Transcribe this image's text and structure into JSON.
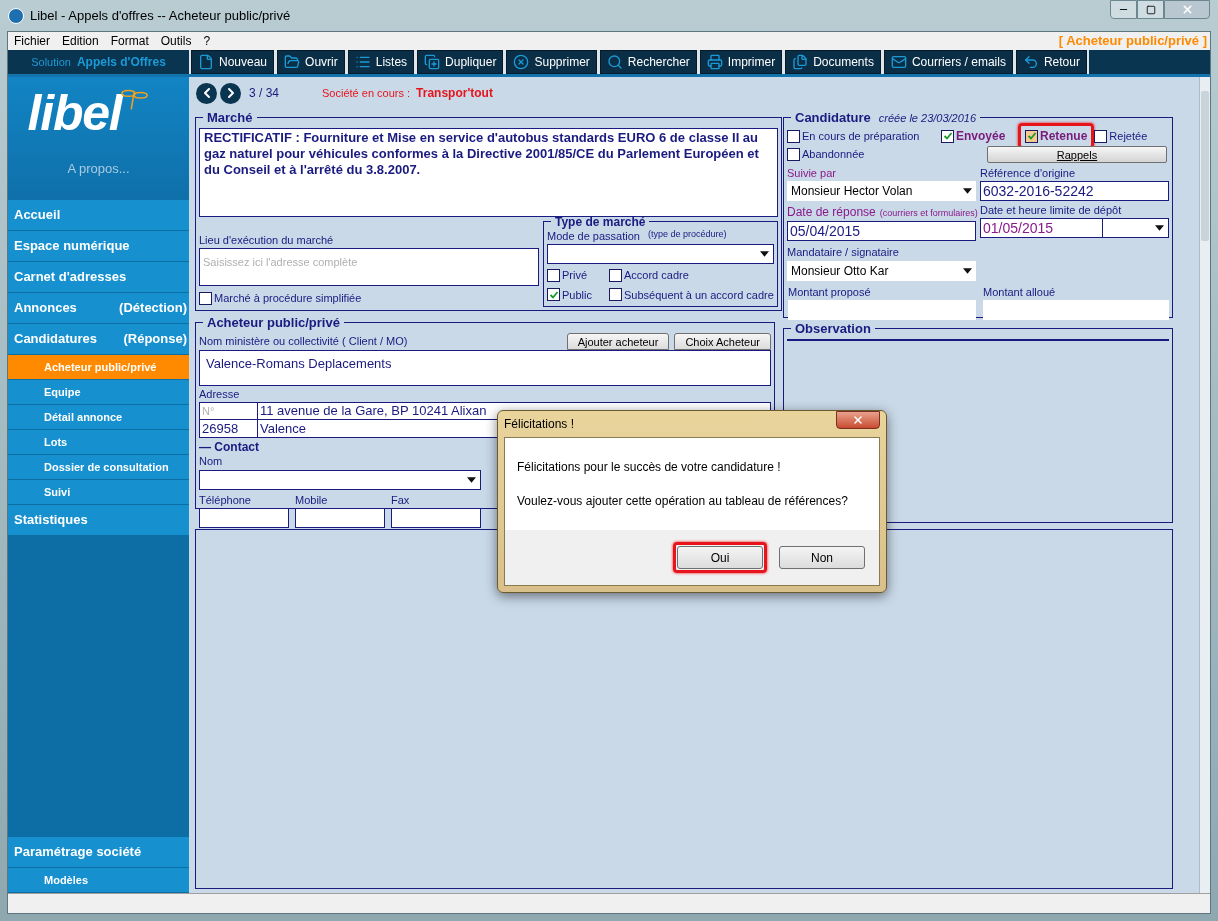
{
  "window": {
    "title": "Libel - Appels d'offres -- Acheteur public/privé"
  },
  "menu": [
    "Fichier",
    "Edition",
    "Format",
    "Outils",
    "?"
  ],
  "current_section": "[ Acheteur public/privé ]",
  "brand": {
    "prefix": "Solution",
    "name": "Appels d'Offres"
  },
  "toolbar": [
    {
      "label": "Nouveau",
      "kind": "new"
    },
    {
      "label": "Ouvrir",
      "kind": "open"
    },
    {
      "label": "Listes",
      "kind": "list"
    },
    {
      "label": "Dupliquer",
      "kind": "duplicate"
    },
    {
      "label": "Supprimer",
      "kind": "delete"
    },
    {
      "label": "Rechercher",
      "kind": "search"
    },
    {
      "label": "Imprimer",
      "kind": "print"
    },
    {
      "label": "Documents",
      "kind": "documents"
    },
    {
      "label": "Courriers / emails",
      "kind": "mail"
    },
    {
      "label": "Retour",
      "kind": "back"
    }
  ],
  "sidebar": {
    "logo": "libel",
    "about": "A propos...",
    "items": [
      {
        "label": "Accueil",
        "selected": false
      },
      {
        "label": "Espace numérique",
        "selected": false
      },
      {
        "label": "Carnet d'adresses",
        "selected": false
      },
      {
        "label": "Annonces",
        "note": "(Détection)",
        "selected": false
      },
      {
        "label": "Candidatures",
        "note": "(Réponse)",
        "selected": false,
        "children": [
          {
            "label": "Acheteur public/privé",
            "selected": true
          },
          {
            "label": "Equipe",
            "selected": false
          },
          {
            "label": "Détail annonce",
            "selected": false
          },
          {
            "label": "Lots",
            "selected": false
          },
          {
            "label": "Dossier de consultation",
            "selected": false
          },
          {
            "label": "Suivi",
            "selected": false
          }
        ]
      },
      {
        "label": "Statistiques",
        "selected": false
      }
    ],
    "footer_items": [
      {
        "label": "Paramétrage société",
        "selected": false,
        "children": [
          {
            "label": "Modèles",
            "selected": false
          }
        ]
      }
    ]
  },
  "nav": {
    "position": "3 / 34",
    "company_label": "Société en cours :",
    "company": "Transpor'tout"
  },
  "marche": {
    "title": "Marché",
    "description": "RECTIFICATIF : Fourniture et Mise en service d'autobus standards EURO 6 de classe II au gaz naturel pour véhicules conformes à la Directive 2001/85/CE du Parlement Européen et du Conseil et à l'arrêté du 3.8.2007.",
    "lieu_label": "Lieu d'exécution du marché",
    "lieu_placeholder": "Saisissez ici l'adresse complète",
    "simplified": {
      "label": "Marché à procédure simplifiée",
      "checked": false
    },
    "type": {
      "title": "Type de marché",
      "mode_label": "Mode de passation",
      "mode_hint": "(type de procédure)",
      "options": [
        {
          "label": "Privé",
          "checked": false
        },
        {
          "label": "Accord cadre",
          "checked": false
        },
        {
          "label": "Public",
          "checked": true
        },
        {
          "label": "Subséquent à un accord cadre",
          "checked": false
        }
      ]
    }
  },
  "candidature": {
    "title": "Candidature",
    "created": "créée le 23/03/2016",
    "statuses": [
      {
        "label": "En cours de préparation",
        "checked": false,
        "highlighted": false
      },
      {
        "label": "Envoyée",
        "checked": true,
        "highlighted": false
      },
      {
        "label": "Retenue",
        "checked": true,
        "highlighted": true
      },
      {
        "label": "Rejetée",
        "checked": false,
        "highlighted": false
      },
      {
        "label": "Abandonnée",
        "checked": false,
        "highlighted": false
      }
    ],
    "rappels": "Rappels",
    "suivie_label": "Suivie par",
    "suivie_value": "Monsieur Hector Volan",
    "reference_label": "Référence d'origine",
    "reference_value": "6032-2016-52242",
    "date_reponse_label": "Date de réponse",
    "date_reponse_hint": "(courriers et formulaires)",
    "date_reponse_value": "05/04/2015",
    "date_limite_label": "Date et heure limite de dépôt",
    "date_limite_value": "01/05/2015",
    "mandataire_label": "Mandataire / signataire",
    "mandataire_value": "Monsieur Otto Kar",
    "montant_propose_label": "Montant proposé",
    "montant_alloue_label": "Montant alloué"
  },
  "acheteur": {
    "title": "Acheteur public/privé",
    "nom_label": "Nom ministère ou collectivité ( Client / MO)",
    "buttons": [
      "Ajouter acheteur",
      "Choix Acheteur"
    ],
    "nom_value": "Valence-Romans Deplacements",
    "adresse_label": "Adresse",
    "numero_placeholder": "N°",
    "rue": "11 avenue de la Gare, BP 10241 Alixan",
    "code_postal": "26958",
    "ville": "Valence",
    "contact_title": "— Contact",
    "contact_nom_label": "Nom",
    "phone_labels": [
      "Téléphone",
      "Mobile",
      "Fax"
    ]
  },
  "observation": {
    "title": "Observation"
  },
  "dialog": {
    "title": "Félicitations !",
    "lines": [
      "Félicitations pour le succès de votre candidature !",
      "Voulez-vous ajouter cette opération au tableau de références?"
    ],
    "buttons": [
      {
        "label": "Oui",
        "highlighted": true
      },
      {
        "label": "Non",
        "highlighted": false
      }
    ]
  }
}
